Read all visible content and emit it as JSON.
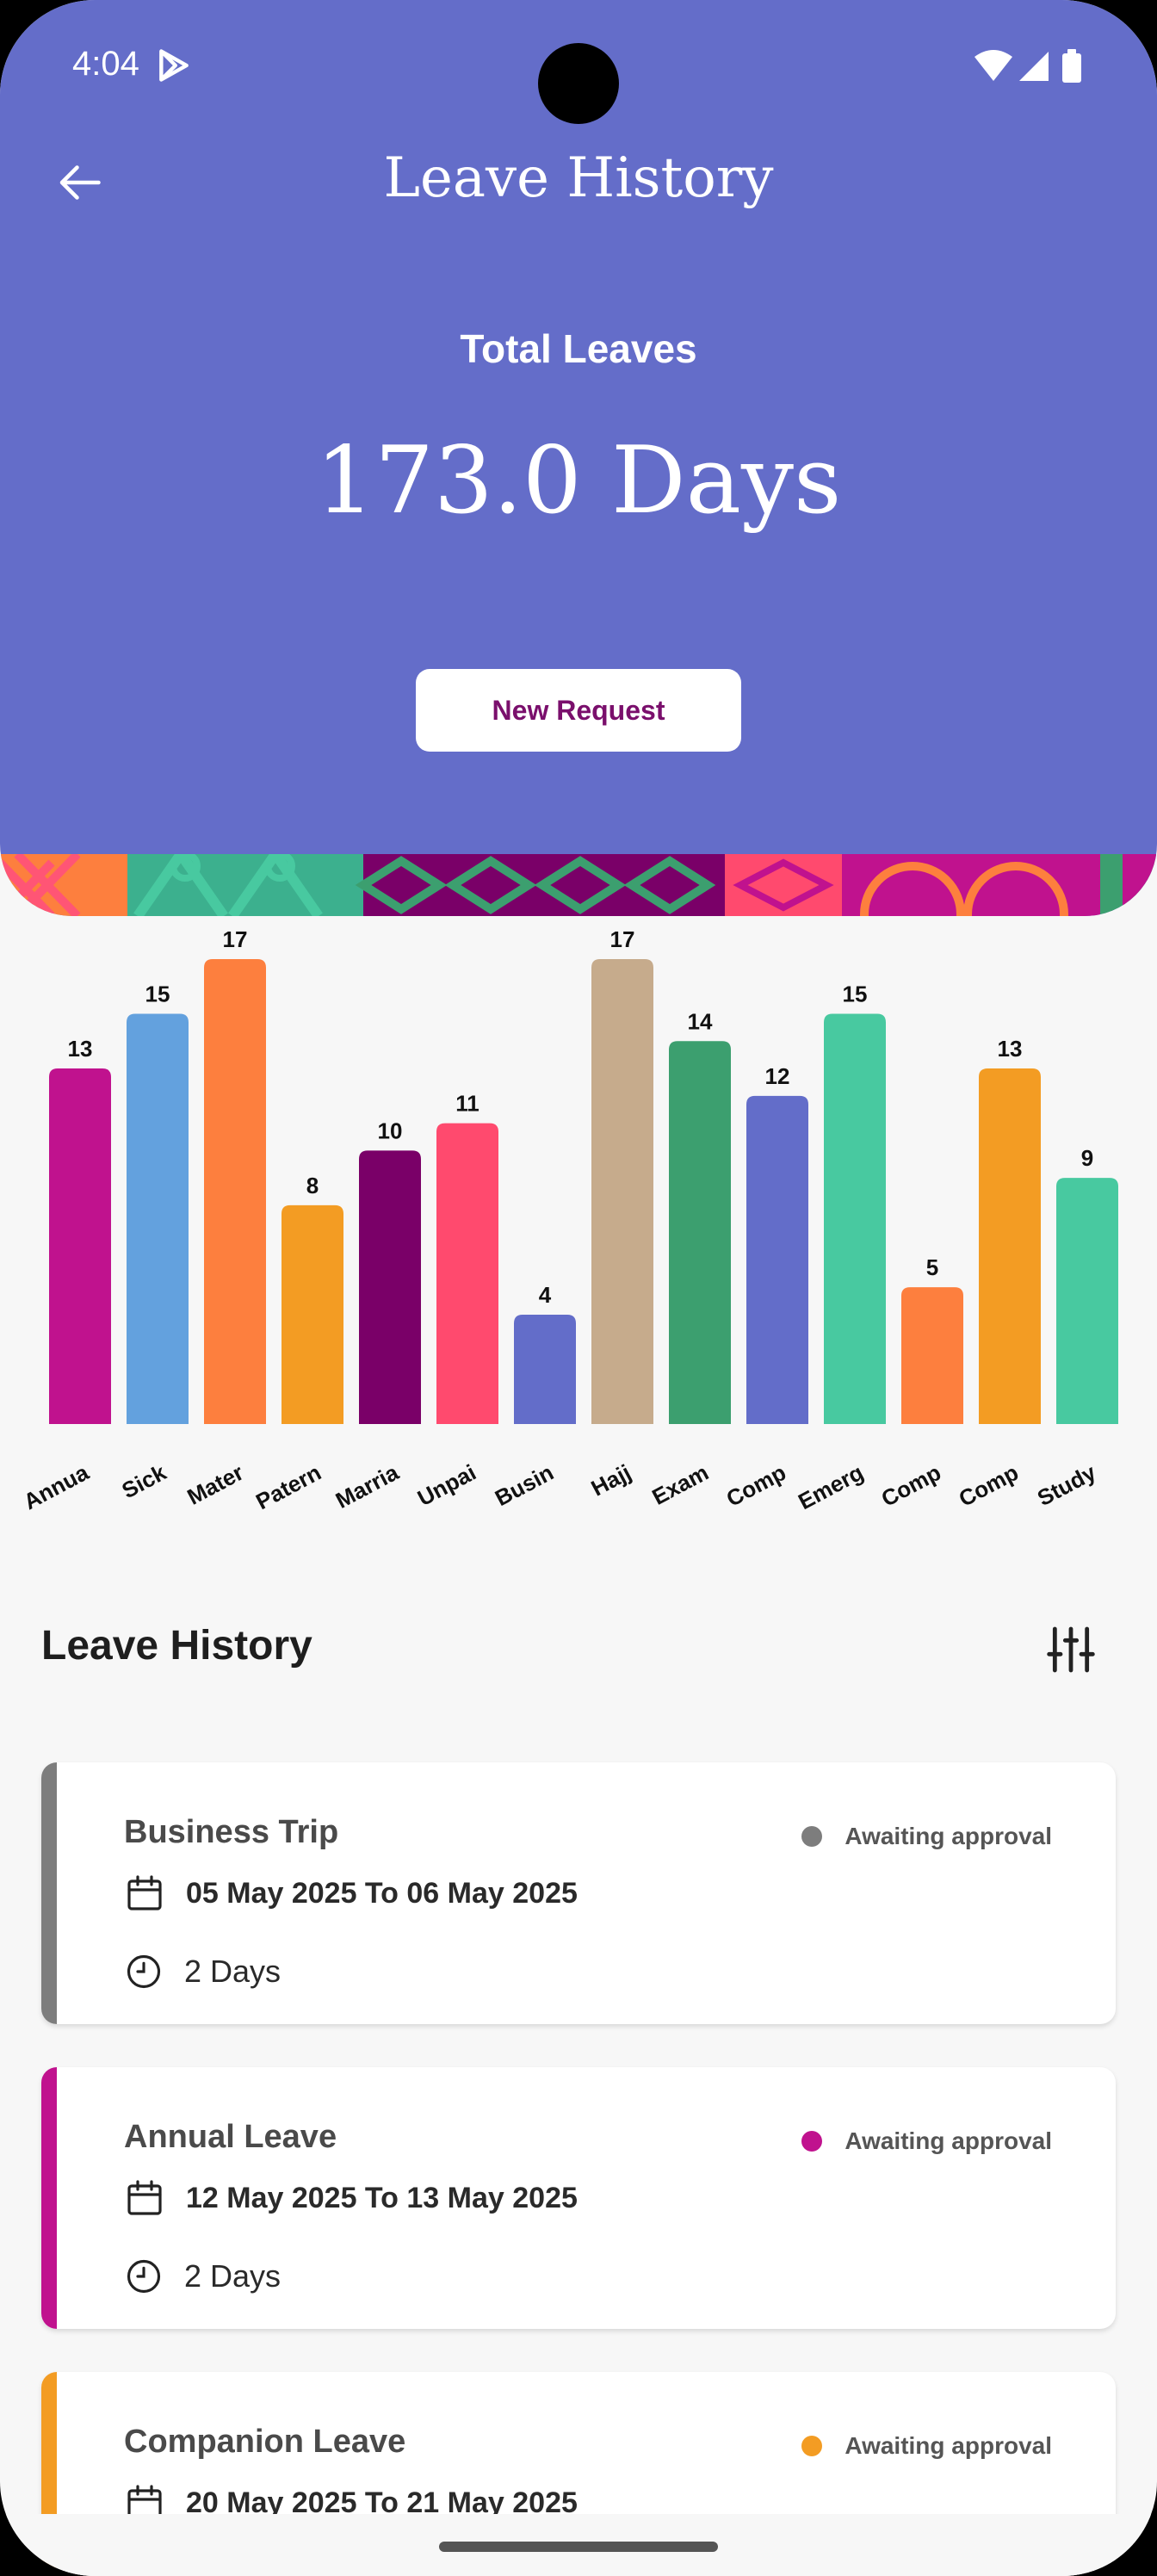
{
  "status_bar": {
    "time": "4:04"
  },
  "header": {
    "title": "Leave History",
    "total_label": "Total Leaves",
    "total_value": "173.0 Days",
    "new_request_label": "New Request",
    "background": "#646dc9"
  },
  "chart_data": {
    "type": "bar",
    "categories": [
      "Annua",
      "Sick",
      "Mater",
      "Patern",
      "Marria",
      "Unpai",
      "Busin",
      "Hajj",
      "Exam",
      "Comp",
      "Emerg",
      "Comp",
      "Comp",
      "Study"
    ],
    "values": [
      13,
      15,
      17,
      8,
      10,
      11,
      4,
      17,
      14,
      12,
      15,
      5,
      13,
      9
    ],
    "colors": [
      "#c0128e",
      "#63a1de",
      "#fd7f3e",
      "#f39c23",
      "#7a0068",
      "#ff4a6e",
      "#636dc9",
      "#c6ab8c",
      "#3c9f6f",
      "#636dc9",
      "#48c9a0",
      "#fd7f3e",
      "#f39c23",
      "#48c9a0"
    ],
    "ylim": [
      0,
      17
    ],
    "grid": false,
    "legend": "none"
  },
  "history": {
    "title": "Leave History",
    "items": [
      {
        "title": "Business Trip",
        "status": "Awaiting approval",
        "dates": "05 May 2025 To 06 May 2025",
        "days": "2 Days",
        "accent": "#7d7d7d"
      },
      {
        "title": "Annual Leave",
        "status": "Awaiting approval",
        "dates": "12 May 2025 To 13 May 2025",
        "days": "2 Days",
        "accent": "#c0128e"
      },
      {
        "title": "Companion Leave",
        "status": "Awaiting approval",
        "dates": "20 May 2025 To 21 May 2025",
        "days": "",
        "accent": "#f39c23"
      }
    ]
  }
}
